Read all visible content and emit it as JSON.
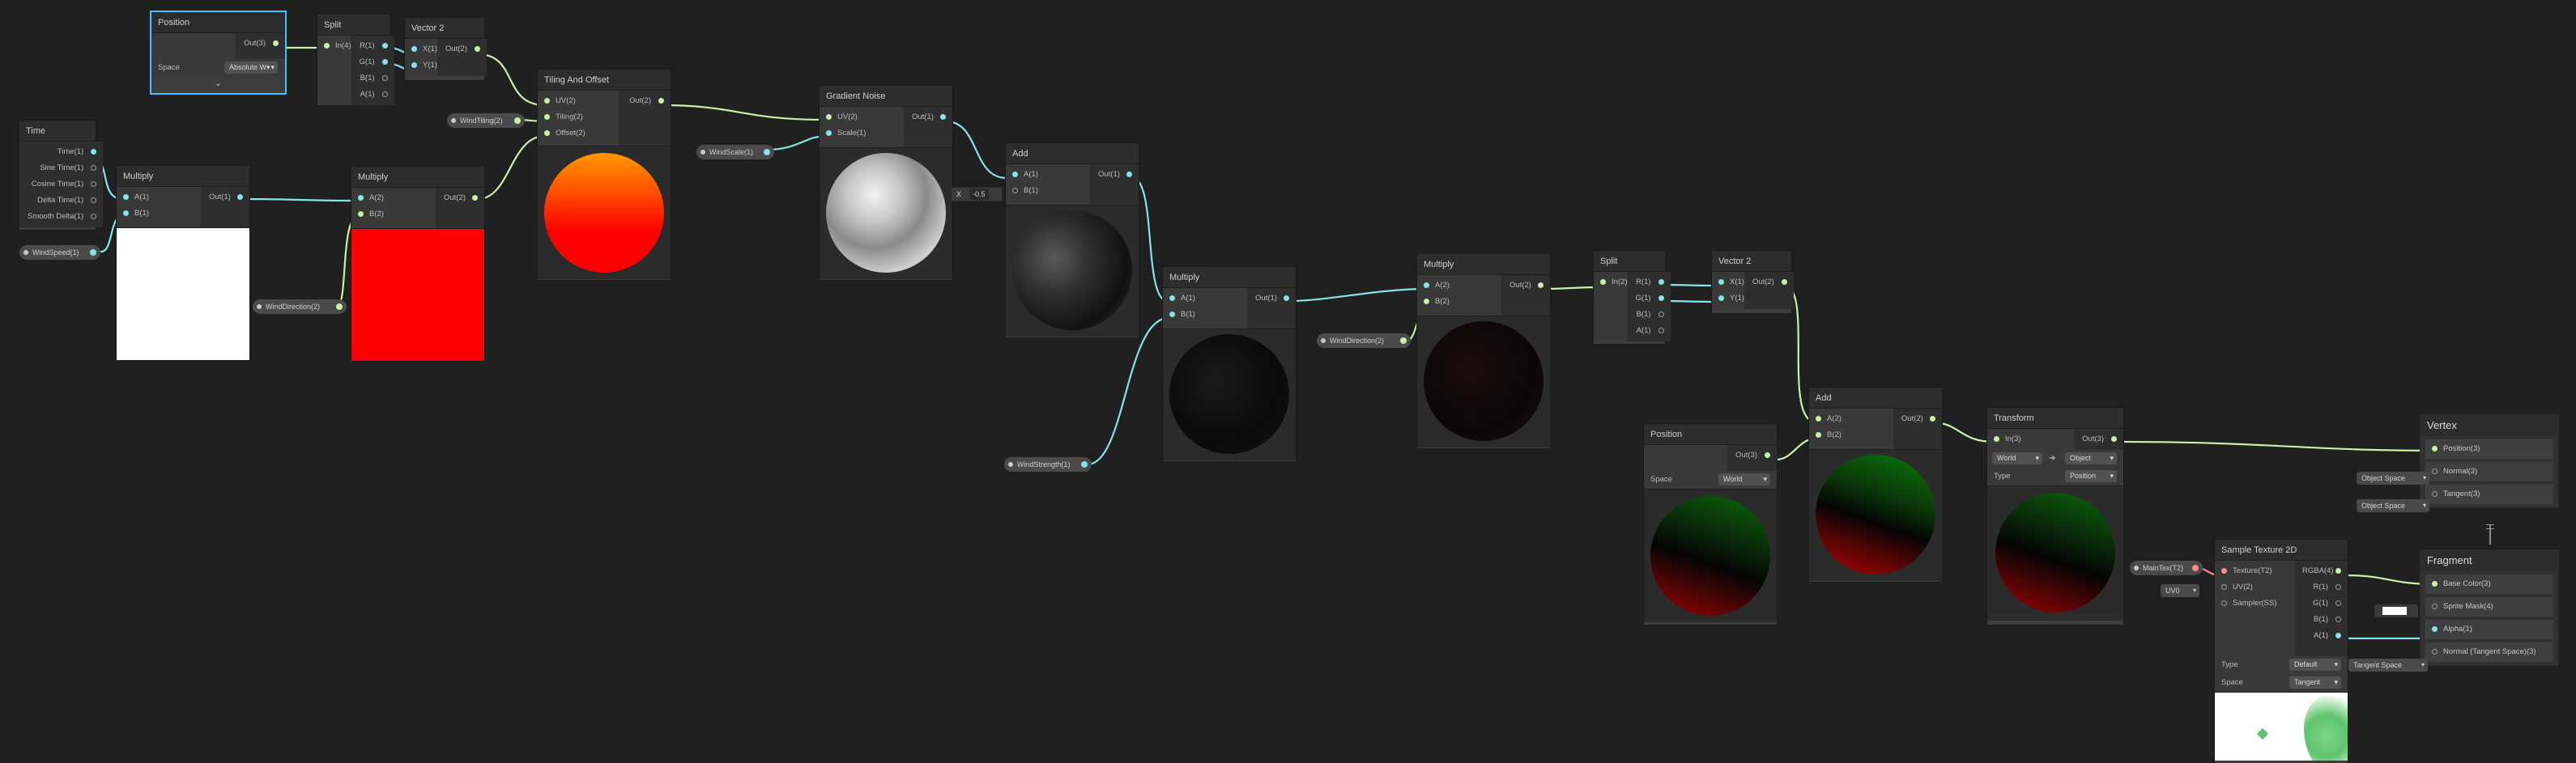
{
  "nodes": {
    "position1": {
      "title": "Position",
      "out": "Out(3)",
      "space_label": "Space",
      "space_value": "Absolute W▾"
    },
    "split1": {
      "title": "Split",
      "in": "In(4)",
      "outs": [
        "R(1)",
        "G(1)",
        "B(1)",
        "A(1)"
      ]
    },
    "vector2a": {
      "title": "Vector 2",
      "ins": [
        "X(1)",
        "Y(1)"
      ],
      "out": "Out(2)"
    },
    "time": {
      "title": "Time",
      "outs": [
        "Time(1)",
        "Sine Time(1)",
        "Cosine Time(1)",
        "Delta Time(1)",
        "Smooth Delta(1)"
      ]
    },
    "multiply1": {
      "title": "Multiply",
      "ins": [
        "A(1)",
        "B(1)"
      ],
      "out": "Out(1)"
    },
    "multiply2": {
      "title": "Multiply",
      "ins": [
        "A(2)",
        "B(2)"
      ],
      "out": "Out(2)"
    },
    "tiling": {
      "title": "Tiling And Offset",
      "ins": [
        "UV(2)",
        "Tiling(2)",
        "Offset(2)"
      ],
      "out": "Out(2)"
    },
    "noise": {
      "title": "Gradient Noise",
      "ins": [
        "UV(2)",
        "Scale(1)"
      ],
      "out": "Out(1)"
    },
    "add1": {
      "title": "Add",
      "ins": [
        "A(1)",
        "B(1)"
      ],
      "out": "Out(1)",
      "b_inline_label": "X",
      "b_inline_value": "-0.5"
    },
    "multiply3": {
      "title": "Multiply",
      "ins": [
        "A(1)",
        "B(1)"
      ],
      "out": "Out(1)"
    },
    "multiply4": {
      "title": "Multiply",
      "ins": [
        "A(2)",
        "B(2)"
      ],
      "out": "Out(2)"
    },
    "split2": {
      "title": "Split",
      "in": "In(2)",
      "outs": [
        "R(1)",
        "G(1)",
        "B(1)",
        "A(1)"
      ]
    },
    "vector2b": {
      "title": "Vector 2",
      "ins": [
        "X(1)",
        "Y(1)"
      ],
      "out": "Out(2)"
    },
    "position2": {
      "title": "Position",
      "out": "Out(3)",
      "space_label": "Space",
      "space_value": "World"
    },
    "add2": {
      "title": "Add",
      "ins": [
        "A(2)",
        "B(2)"
      ],
      "out": "Out(2)"
    },
    "transform": {
      "title": "Transform",
      "in": "In(3)",
      "out": "Out(3)",
      "from": "World",
      "to": "Object",
      "type_label": "Type",
      "type_value": "Position"
    },
    "sample": {
      "title": "Sample Texture 2D",
      "ins": [
        "Texture(T2)",
        "UV(2)",
        "Sampler(SS)"
      ],
      "outs": [
        "RGBA(4)",
        "R(1)",
        "G(1)",
        "B(1)",
        "A(1)"
      ],
      "type_label": "Type",
      "type_value": "Default",
      "space_label": "Space",
      "space_value": "Tangent"
    }
  },
  "properties": {
    "windspeed": "WindSpeed(1)",
    "winddirection1": "WindDirection(2)",
    "windtiling": "WindTiling(2)",
    "windscale": "WindScale(1)",
    "windstrength": "WindStrength(1)",
    "winddirection2": "WindDirection(2)",
    "maintex": "MainTex(T2)",
    "uv_chip": "UV0"
  },
  "vertex": {
    "title": "Vertex",
    "slots": [
      "Position(3)",
      "Normal(3)",
      "Tangent(3)"
    ],
    "normal_space": "Object Space",
    "tangent_space": "Object Space"
  },
  "fragment": {
    "title": "Fragment",
    "slots": [
      "Base Color(3)",
      "Sprite Mask(4)",
      "Alpha(1)",
      "Normal (Tangent Space)(3)"
    ],
    "normal_space": "Tangent Space"
  },
  "colors": {
    "wire_float": "#84e4e7",
    "wire_vector": "#c7f0a8",
    "wire_texture": "#ff8a8a",
    "selection": "#44c0ff",
    "background": "#202020"
  }
}
